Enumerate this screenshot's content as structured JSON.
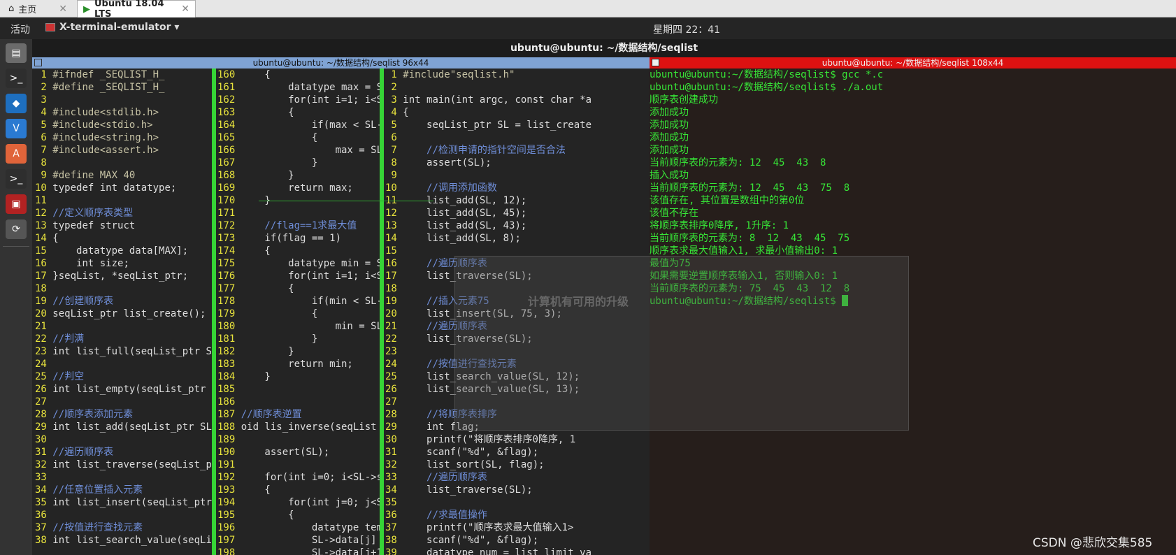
{
  "vm_tabs": [
    {
      "label": "主页"
    },
    {
      "label": "Ubuntu 18.04 LTS"
    }
  ],
  "topbar": {
    "activities": "活动",
    "app_menu": "X-terminal-emulator ▾",
    "clock": "星期四 22：41"
  },
  "window_title": "ubuntu@ubuntu: ~/数据结构/seqlist",
  "left_pane": {
    "title": "ubuntu@ubuntu: ~/数据结构/seqlist 96x44"
  },
  "right_pane": {
    "title": "ubuntu@ubuntu: ~/数据结构/seqlist 108x44"
  },
  "editor": {
    "col1": [
      {
        "n": "1",
        "t": "#ifndef _SEQLIST_H_"
      },
      {
        "n": "2",
        "t": "#define _SEQLIST_H_"
      },
      {
        "n": "3",
        "t": ""
      },
      {
        "n": "4",
        "t": "#include<stdlib.h>"
      },
      {
        "n": "5",
        "t": "#include<stdio.h>"
      },
      {
        "n": "6",
        "t": "#include<string.h>"
      },
      {
        "n": "7",
        "t": "#include<assert.h>"
      },
      {
        "n": "8",
        "t": ""
      },
      {
        "n": "9",
        "t": "#define MAX 40"
      },
      {
        "n": "10",
        "t": "typedef int datatype;"
      },
      {
        "n": "11",
        "t": ""
      },
      {
        "n": "12",
        "t": "//定义顺序表类型"
      },
      {
        "n": "13",
        "t": "typedef struct"
      },
      {
        "n": "14",
        "t": "{"
      },
      {
        "n": "15",
        "t": "    datatype data[MAX];"
      },
      {
        "n": "16",
        "t": "    int size;"
      },
      {
        "n": "17",
        "t": "}seqList, *seqList_ptr;"
      },
      {
        "n": "18",
        "t": ""
      },
      {
        "n": "19",
        "t": "//创建顺序表"
      },
      {
        "n": "20",
        "t": "seqList_ptr list_create();"
      },
      {
        "n": "21",
        "t": ""
      },
      {
        "n": "22",
        "t": "//判满"
      },
      {
        "n": "23",
        "t": "int list_full(seqList_ptr S"
      },
      {
        "n": "24",
        "t": ""
      },
      {
        "n": "25",
        "t": "//判空"
      },
      {
        "n": "26",
        "t": "int list_empty(seqList_ptr "
      },
      {
        "n": "27",
        "t": ""
      },
      {
        "n": "28",
        "t": "//顺序表添加元素"
      },
      {
        "n": "29",
        "t": "int list_add(seqList_ptr SL"
      },
      {
        "n": "30",
        "t": ""
      },
      {
        "n": "31",
        "t": "//遍历顺序表"
      },
      {
        "n": "32",
        "t": "int list_traverse(seqList_p"
      },
      {
        "n": "33",
        "t": ""
      },
      {
        "n": "34",
        "t": "//任意位置插入元素"
      },
      {
        "n": "35",
        "t": "int list_insert(seqList_ptr"
      },
      {
        "n": "36",
        "t": ""
      },
      {
        "n": "37",
        "t": "//按值进行查找元素"
      },
      {
        "n": "38",
        "t": "int list_search_value(seqLi"
      }
    ],
    "col2": [
      {
        "n": "160",
        "t": "    {"
      },
      {
        "n": "161",
        "t": "        datatype max = S"
      },
      {
        "n": "162",
        "t": "        for(int i=1; i<S"
      },
      {
        "n": "163",
        "t": "        {"
      },
      {
        "n": "164",
        "t": "            if(max < SL-"
      },
      {
        "n": "165",
        "t": "            {"
      },
      {
        "n": "166",
        "t": "                max = SL"
      },
      {
        "n": "167",
        "t": "            }"
      },
      {
        "n": "168",
        "t": "        }"
      },
      {
        "n": "169",
        "t": "        return max;"
      },
      {
        "n": "170",
        "t": "    }"
      },
      {
        "n": "171",
        "t": ""
      },
      {
        "n": "172",
        "t": "    //flag==1求最大值"
      },
      {
        "n": "173",
        "t": "    if(flag == 1)"
      },
      {
        "n": "174",
        "t": "    {"
      },
      {
        "n": "175",
        "t": "        datatype min = S"
      },
      {
        "n": "176",
        "t": "        for(int i=1; i<S"
      },
      {
        "n": "177",
        "t": "        {"
      },
      {
        "n": "178",
        "t": "            if(min < SL-"
      },
      {
        "n": "179",
        "t": "            {"
      },
      {
        "n": "180",
        "t": "                min = SL"
      },
      {
        "n": "181",
        "t": "            }"
      },
      {
        "n": "182",
        "t": "        }"
      },
      {
        "n": "183",
        "t": "        return min;"
      },
      {
        "n": "184",
        "t": "    }"
      },
      {
        "n": "185",
        "t": ""
      },
      {
        "n": "186",
        "t": ""
      },
      {
        "n": "187",
        "t": "//顺序表逆置"
      },
      {
        "n": "188",
        "t": "oid lis_inverse(seqList"
      },
      {
        "n": "189",
        "t": ""
      },
      {
        "n": "190",
        "t": "    assert(SL);"
      },
      {
        "n": "191",
        "t": ""
      },
      {
        "n": "192",
        "t": "    for(int i=0; i<SL->s"
      },
      {
        "n": "193",
        "t": "    {"
      },
      {
        "n": "194",
        "t": "        for(int j=0; j<S"
      },
      {
        "n": "195",
        "t": "        {"
      },
      {
        "n": "196",
        "t": "            datatype tem"
      },
      {
        "n": "197",
        "t": "            SL->data[j]"
      },
      {
        "n": "198",
        "t": "            SL->data[j+1"
      }
    ],
    "col3": [
      {
        "n": "1",
        "t": "#include\"seqlist.h\""
      },
      {
        "n": "2",
        "t": ""
      },
      {
        "n": "3",
        "t": "int main(int argc, const char *a"
      },
      {
        "n": "4",
        "t": "{"
      },
      {
        "n": "5",
        "t": "    seqList_ptr SL = list_create"
      },
      {
        "n": "6",
        "t": ""
      },
      {
        "n": "7",
        "t": "    //检测申请的指针空间是否合法"
      },
      {
        "n": "8",
        "t": "    assert(SL);"
      },
      {
        "n": "9",
        "t": ""
      },
      {
        "n": "10",
        "t": "    //调用添加函数"
      },
      {
        "n": "11",
        "t": "    list_add(SL, 12);"
      },
      {
        "n": "12",
        "t": "    list_add(SL, 45);"
      },
      {
        "n": "13",
        "t": "    list_add(SL, 43);"
      },
      {
        "n": "14",
        "t": "    list_add(SL, 8);"
      },
      {
        "n": "15",
        "t": ""
      },
      {
        "n": "16",
        "t": "    //遍历顺序表"
      },
      {
        "n": "17",
        "t": "    list_traverse(SL);"
      },
      {
        "n": "18",
        "t": ""
      },
      {
        "n": "19",
        "t": "    //插入元素75"
      },
      {
        "n": "20",
        "t": "    list_insert(SL, 75, 3);"
      },
      {
        "n": "21",
        "t": "    //遍历顺序表"
      },
      {
        "n": "22",
        "t": "    list_traverse(SL);"
      },
      {
        "n": "23",
        "t": ""
      },
      {
        "n": "24",
        "t": "    //按值进行查找元素"
      },
      {
        "n": "25",
        "t": "    list_search_value(SL, 12);"
      },
      {
        "n": "26",
        "t": "    list_search_value(SL, 13);"
      },
      {
        "n": "27",
        "t": ""
      },
      {
        "n": "28",
        "t": "    //将顺序表排序"
      },
      {
        "n": "29",
        "t": "    int flag;"
      },
      {
        "n": "30",
        "t": "    printf(\"将顺序表排序0降序, 1"
      },
      {
        "n": "31",
        "t": "    scanf(\"%d\", &flag);"
      },
      {
        "n": "32",
        "t": "    list_sort(SL, flag);"
      },
      {
        "n": "33",
        "t": "    //遍历顺序表"
      },
      {
        "n": "34",
        "t": "    list_traverse(SL);"
      },
      {
        "n": "35",
        "t": ""
      },
      {
        "n": "36",
        "t": "    //求最值操作"
      },
      {
        "n": "37",
        "t": "    printf(\"顺序表求最大值输入1>"
      },
      {
        "n": "38",
        "t": "    scanf(\"%d\", &flag);"
      },
      {
        "n": "39",
        "t": "    datatype num = list_limit_va"
      }
    ]
  },
  "terminal_lines": [
    "ubuntu@ubuntu:~/数据结构/seqlist$ gcc *.c",
    "ubuntu@ubuntu:~/数据结构/seqlist$ ./a.out",
    "顺序表创建成功",
    "添加成功",
    "添加成功",
    "添加成功",
    "添加成功",
    "当前顺序表的元素为: 12  45  43  8",
    "插入成功",
    "当前顺序表的元素为: 12  45  43  75  8",
    "该值存在, 其位置是数组中的第0位",
    "该值不存在",
    "将顺序表排序0降序, 1升序: 1",
    "当前顺序表的元素为: 8  12  43  45  75",
    "顺序表求最大值输入1, 求最小值输出0: 1",
    "最值为75",
    "如果需要逆置顺序表输入1, 否则输入0: 1",
    "当前顺序表的元素为: 75  45  43  12  8",
    "ubuntu@ubuntu:~/数据结构/seqlist$ "
  ],
  "ghost_dialog_text": "计算机有可用的升级",
  "watermark": "CSDN @悲欣交集585",
  "dock": [
    {
      "icon": "files-icon",
      "glyph": "▤",
      "color": "#6b6b6b"
    },
    {
      "icon": "terminal-icon",
      "glyph": ">_",
      "color": "#2e2e2e"
    },
    {
      "icon": "vscode-icon",
      "glyph": "◆",
      "color": "#1e6fbf"
    },
    {
      "icon": "visual-editor-icon",
      "glyph": "V",
      "color": "#2a7ad1"
    },
    {
      "icon": "software-center-icon",
      "glyph": "A",
      "color": "#e0643a"
    },
    {
      "icon": "terminal-2-icon",
      "glyph": ">_",
      "color": "#2e2e2e"
    },
    {
      "icon": "x-terminal-icon",
      "glyph": "▣",
      "color": "#b22222"
    },
    {
      "icon": "update-icon",
      "glyph": "⟳",
      "color": "#555555"
    }
  ]
}
